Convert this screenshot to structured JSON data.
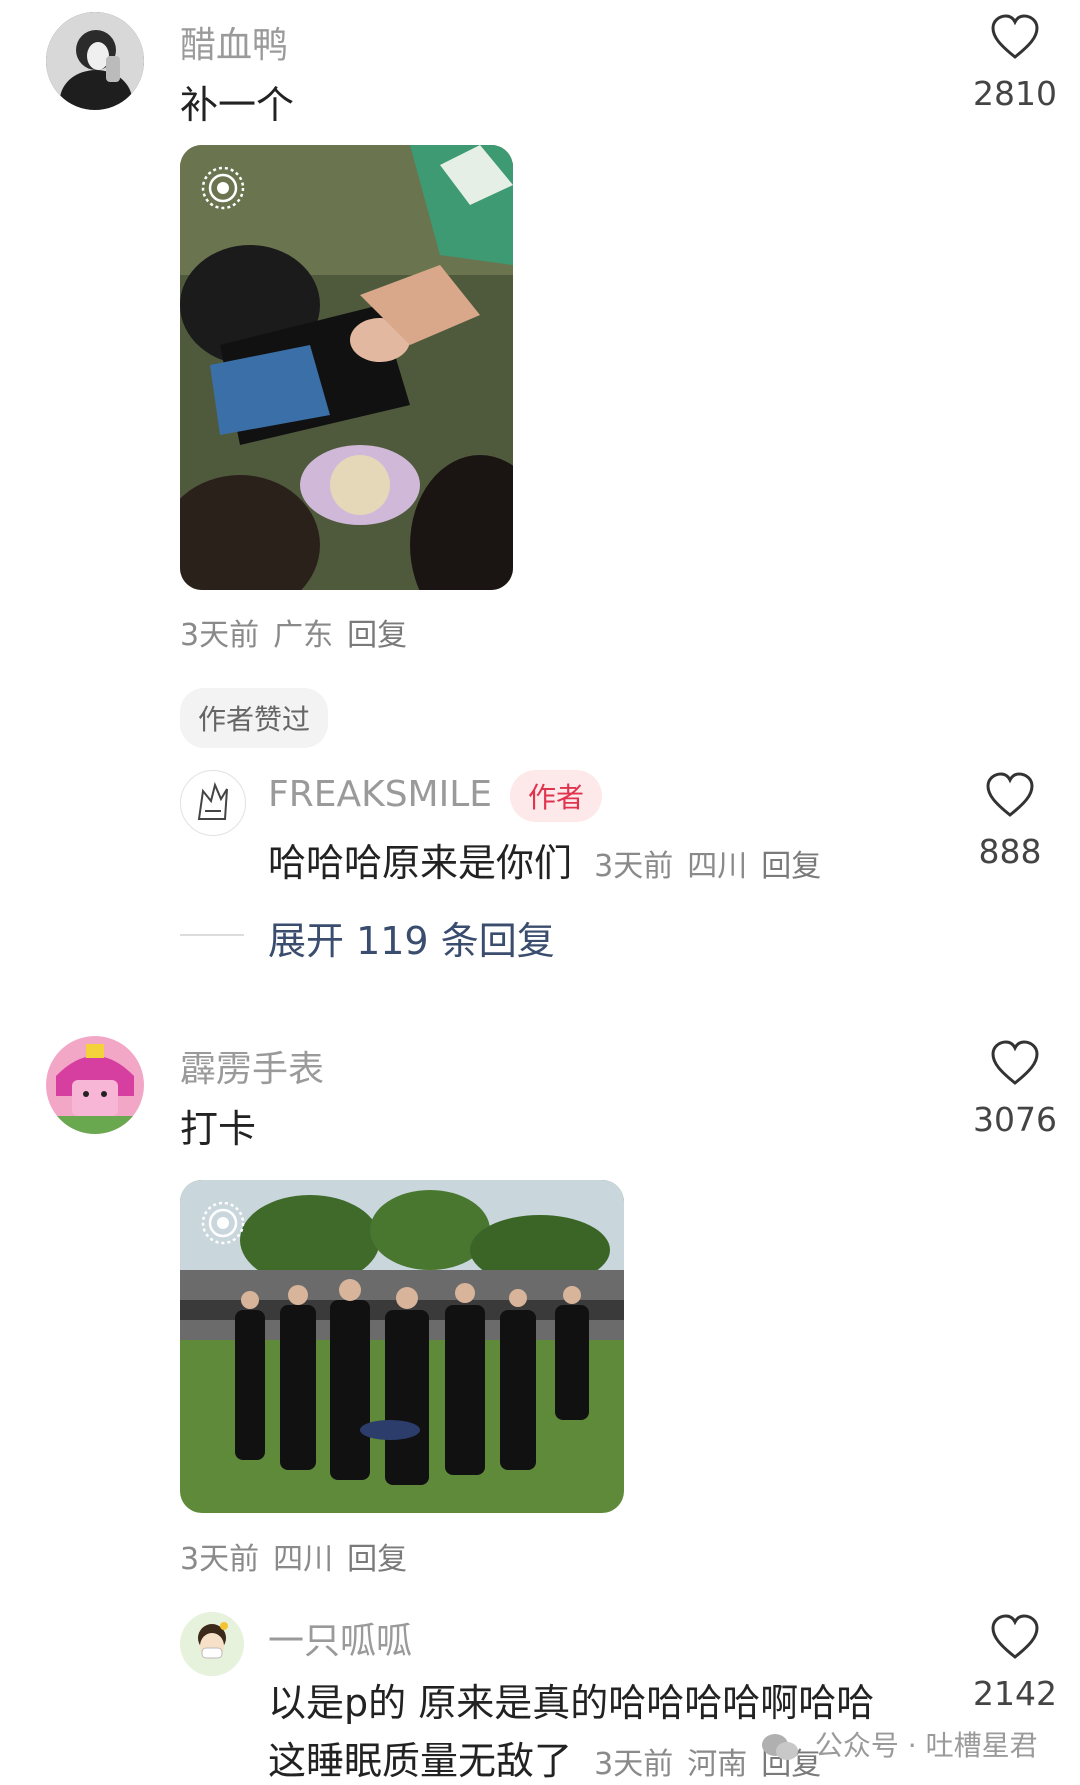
{
  "comments": [
    {
      "username": "醋血鸭",
      "text": "补一个",
      "likes": "2810",
      "time": "3天前",
      "location": "广东",
      "reply_label": "回复",
      "image_icon": "live-photo-icon",
      "badge": "作者赞过",
      "reply": {
        "username": "FREAKSMILE",
        "author_label": "作者",
        "text": "哈哈哈原来是你们",
        "time": "3天前",
        "location": "四川",
        "reply_label": "回复",
        "likes": "888"
      },
      "expand_label": "展开 119 条回复"
    },
    {
      "username": "霹雳手表",
      "text": "打卡",
      "likes": "3076",
      "time": "3天前",
      "location": "四川",
      "reply_label": "回复",
      "image_icon": "live-photo-icon",
      "reply": {
        "username": "一只呱呱",
        "text_line1": "以是p的 原来是真的哈哈哈哈啊哈哈",
        "text_line2": "这睡眠质量无敌了",
        "time": "3天前",
        "location": "河南",
        "reply_label": "回复",
        "likes": "2142"
      }
    }
  ],
  "watermark": "公众号 · 吐槽星君",
  "colors": {
    "author_badge": "#e0344d",
    "expand_link": "#3a4d6e"
  }
}
